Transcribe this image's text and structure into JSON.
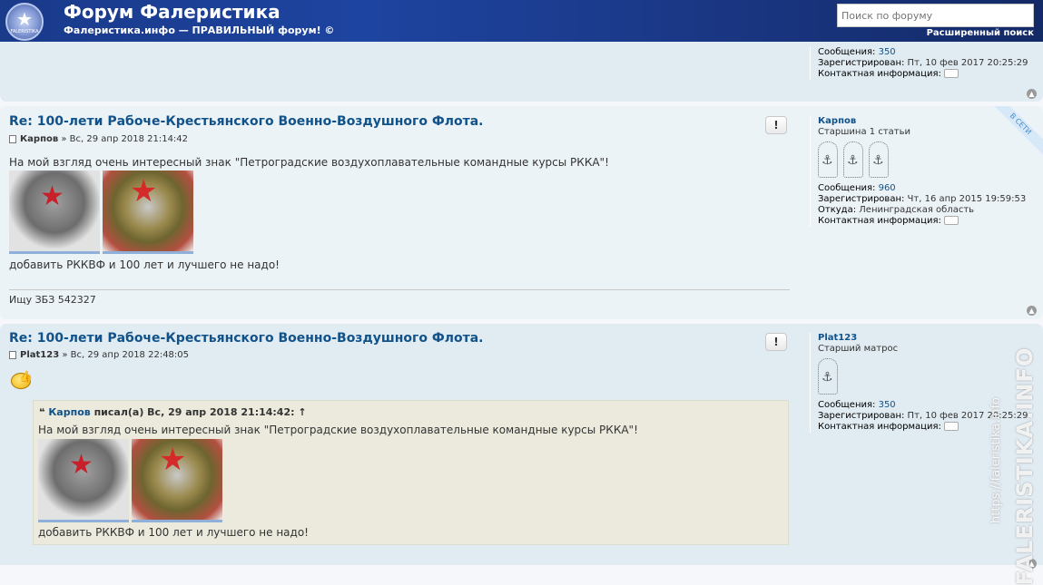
{
  "header": {
    "logo_text": "FALERISTIKA",
    "title": "Форум Фалеристика",
    "description": "Фалеристика.инфо — ПРАВИЛЬНЫЙ форум! ©",
    "search_placeholder": "Поиск по форуму",
    "advanced_search": "Расширенный поиск"
  },
  "post1": {
    "profile": {
      "messages_label": "Сообщения:",
      "messages": "350",
      "registered_label": "Зарегистрирован:",
      "registered": "Пт, 10 фев 2017 20:25:29",
      "contact_label": "Контактная информация:"
    }
  },
  "post2": {
    "title": "Re: 100-лети Рабоче-Крестьянского Военно-Воздушного Флота.",
    "author": "Карпов",
    "date": "» Вс, 29 апр 2018 21:14:42",
    "report": "!",
    "text1": "На мой взгляд очень интересный знак \"Петроградские воздухоплавательные командные курсы РККА\"!",
    "text2": "добавить РККВФ и 100 лет и лучшего не надо!",
    "signature": "Ищу ЗБЗ 542327",
    "online_badge": "В СЕТИ",
    "profile": {
      "username": "Карпов",
      "rank": "Старшина 1 статьи",
      "messages_label": "Сообщения:",
      "messages": "960",
      "registered_label": "Зарегистрирован:",
      "registered": "Чт, 16 апр 2015 19:59:53",
      "from_label": "Откуда:",
      "from": "Ленинградская область",
      "contact_label": "Контактная информация:"
    }
  },
  "post3": {
    "title": "Re: 100-лети Рабоче-Крестьянского Военно-Воздушного Флота.",
    "author": "Plat123",
    "date": "» Вс, 29 апр 2018 22:48:05",
    "report": "!",
    "quote": {
      "author": "Карпов",
      "header_rest": "писал(а) Вс, 29 апр 2018 21:14:42: ↑",
      "text1": "На мой взгляд очень интересный знак \"Петроградские воздухоплавательные командные курсы РККА\"!",
      "text2": "добавить РККВФ и 100 лет и лучшего не надо!"
    },
    "profile": {
      "username": "Plat123",
      "rank": "Старший матрос",
      "messages_label": "Сообщения:",
      "messages": "350",
      "registered_label": "Зарегистрирован:",
      "registered": "Пт, 10 фев 2017 20:25:29",
      "contact_label": "Контактная информация:"
    }
  },
  "watermark": {
    "brand": "FALERISTIKA.INFO",
    "url": "https://faleristika.info"
  }
}
